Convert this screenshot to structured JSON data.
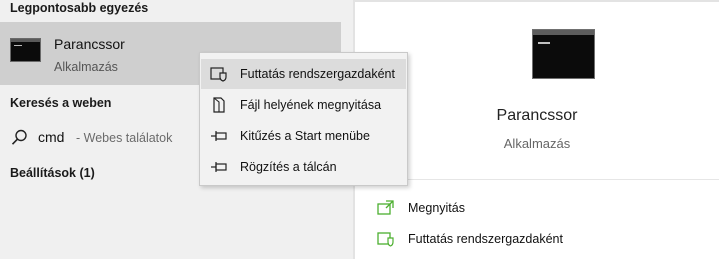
{
  "left": {
    "best_match_title": "Legpontosabb egyezés",
    "best_match": {
      "name": "Parancssor",
      "type": "Alkalmazás"
    },
    "web_title": "Keresés a weben",
    "web_result": {
      "term": "cmd",
      "suffix": "- Webes találatok"
    },
    "settings_title": "Beállítások (1)"
  },
  "context_menu": {
    "items": [
      {
        "label": "Futtatás rendszergazdaként",
        "icon": "shield-icon",
        "highlighted": true
      },
      {
        "label": "Fájl helyének megnyitása",
        "icon": "file-icon"
      },
      {
        "label": "Kitűzés a Start menübe",
        "icon": "pin-icon"
      },
      {
        "label": "Rögzítés a tálcán",
        "icon": "pin-icon"
      }
    ]
  },
  "right": {
    "app_name": "Parancssor",
    "app_type": "Alkalmazás",
    "actions": [
      {
        "label": "Megnyitás",
        "icon": "open-icon"
      },
      {
        "label": "Futtatás rendszergazdaként",
        "icon": "shield-icon"
      }
    ]
  },
  "colors": {
    "accent_green": "#4caf2f"
  }
}
